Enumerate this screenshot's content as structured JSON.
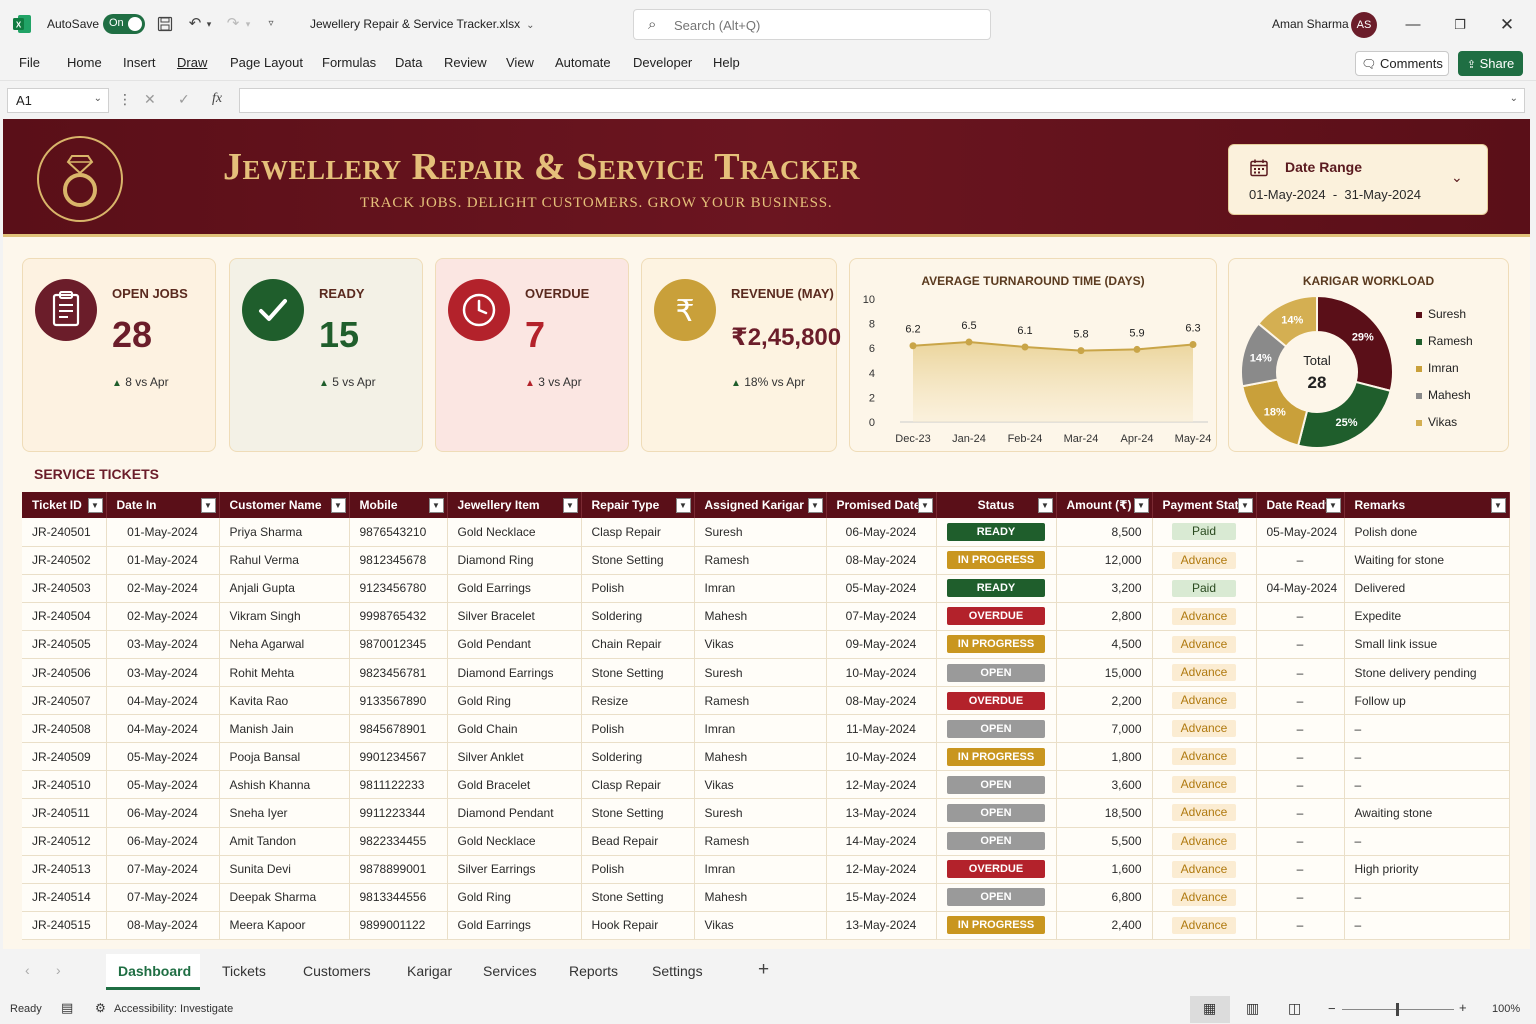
{
  "app": {
    "autosave_label": "AutoSave",
    "autosave_state": "On",
    "file_name": "Jewellery Repair & Service Tracker.xlsx",
    "search_placeholder": "Search (Alt+Q)",
    "user_name": "Aman Sharma",
    "user_initials": "AS"
  },
  "menu": [
    "File",
    "Home",
    "Insert",
    "Draw",
    "Page Layout",
    "Formulas",
    "Data",
    "Review",
    "View",
    "Automate",
    "Developer",
    "Help"
  ],
  "actions": {
    "comments": "Comments",
    "share": "Share"
  },
  "formula_bar": {
    "name_box": "A1",
    "fx": "fx"
  },
  "banner": {
    "title": "Jewellery Repair & Service Tracker",
    "subtitle": "TRACK JOBS. DELIGHT CUSTOMERS. GROW YOUR BUSINESS.",
    "date_label": "Date Range",
    "date_value": "01-May-2024  -  31-May-2024"
  },
  "kpis": [
    {
      "label": "OPEN JOBS",
      "value": "28",
      "delta": "8 vs Apr",
      "color": "#6b1d2a",
      "bg": "#fdf2e1"
    },
    {
      "label": "READY",
      "value": "15",
      "delta": "5 vs Apr",
      "color": "#1f5e2c",
      "bg": "#f3f1e6"
    },
    {
      "label": "OVERDUE",
      "value": "7",
      "delta": "3 vs Apr",
      "color": "#b3222b",
      "bg": "#fbe6e2"
    },
    {
      "label": "REVENUE (MAY)",
      "value": "₹2,45,800",
      "delta": "18% vs Apr",
      "color": "#6b1d2a",
      "bg": "#fdf3e1"
    }
  ],
  "chart_data": [
    {
      "type": "area",
      "title": "AVERAGE TURNAROUND TIME (DAYS)",
      "categories": [
        "Dec-23",
        "Jan-24",
        "Feb-24",
        "Mar-24",
        "Apr-24",
        "May-24"
      ],
      "values": [
        6.2,
        6.5,
        6.1,
        5.8,
        5.9,
        6.3
      ],
      "yticks": [
        "10",
        "8",
        "6",
        "4",
        "2",
        "0"
      ],
      "ylim": [
        0,
        10
      ],
      "grid": false,
      "color": "#c9a548"
    },
    {
      "type": "pie",
      "title": "KARIGAR WORKLOAD",
      "center_label": "Total",
      "center_value": "28",
      "slices": [
        {
          "name": "Suresh",
          "value": 29,
          "label": "29%",
          "color": "#5a0f18"
        },
        {
          "name": "Ramesh",
          "value": 25,
          "label": "25%",
          "color": "#1f5e2c"
        },
        {
          "name": "Imran",
          "value": 18,
          "label": "18%",
          "color": "#c9a03a"
        },
        {
          "name": "Mahesh",
          "value": 14,
          "label": "14%",
          "color": "#8a8a8a"
        },
        {
          "name": "Vikas",
          "value": 14,
          "label": "14%",
          "color": "#d4af52"
        }
      ],
      "legend_position": "right"
    }
  ],
  "tickets": {
    "title": "SERVICE TICKETS",
    "columns": [
      "Ticket ID",
      "Date In",
      "Customer Name",
      "Mobile",
      "Jewellery Item",
      "Repair Type",
      "Assigned Karigar",
      "Promised Date",
      "Status",
      "Amount (₹)",
      "Payment Status",
      "Date Ready",
      "Remarks"
    ],
    "rows": [
      [
        "JR-240501",
        "01-May-2024",
        "Priya Sharma",
        "9876543210",
        "Gold Necklace",
        "Clasp Repair",
        "Suresh",
        "06-May-2024",
        "READY",
        "8,500",
        "Paid",
        "05-May-2024",
        "Polish done"
      ],
      [
        "JR-240502",
        "01-May-2024",
        "Rahul Verma",
        "9812345678",
        "Diamond Ring",
        "Stone Setting",
        "Ramesh",
        "08-May-2024",
        "IN PROGRESS",
        "12,000",
        "Advance",
        "–",
        "Waiting for stone"
      ],
      [
        "JR-240503",
        "02-May-2024",
        "Anjali Gupta",
        "9123456780",
        "Gold Earrings",
        "Polish",
        "Imran",
        "05-May-2024",
        "READY",
        "3,200",
        "Paid",
        "04-May-2024",
        "Delivered"
      ],
      [
        "JR-240504",
        "02-May-2024",
        "Vikram Singh",
        "9998765432",
        "Silver Bracelet",
        "Soldering",
        "Mahesh",
        "07-May-2024",
        "OVERDUE",
        "2,800",
        "Advance",
        "–",
        "Expedite"
      ],
      [
        "JR-240505",
        "03-May-2024",
        "Neha Agarwal",
        "9870012345",
        "Gold Pendant",
        "Chain Repair",
        "Vikas",
        "09-May-2024",
        "IN PROGRESS",
        "4,500",
        "Advance",
        "–",
        "Small link issue"
      ],
      [
        "JR-240506",
        "03-May-2024",
        "Rohit Mehta",
        "9823456781",
        "Diamond Earrings",
        "Stone Setting",
        "Suresh",
        "10-May-2024",
        "OPEN",
        "15,000",
        "Advance",
        "–",
        "Stone delivery pending"
      ],
      [
        "JR-240507",
        "04-May-2024",
        "Kavita Rao",
        "9133567890",
        "Gold Ring",
        "Resize",
        "Ramesh",
        "08-May-2024",
        "OVERDUE",
        "2,200",
        "Advance",
        "–",
        "Follow up"
      ],
      [
        "JR-240508",
        "04-May-2024",
        "Manish Jain",
        "9845678901",
        "Gold Chain",
        "Polish",
        "Imran",
        "11-May-2024",
        "OPEN",
        "7,000",
        "Advance",
        "–",
        "–"
      ],
      [
        "JR-240509",
        "05-May-2024",
        "Pooja Bansal",
        "9901234567",
        "Silver Anklet",
        "Soldering",
        "Mahesh",
        "10-May-2024",
        "IN PROGRESS",
        "1,800",
        "Advance",
        "–",
        "–"
      ],
      [
        "JR-240510",
        "05-May-2024",
        "Ashish Khanna",
        "9811122233",
        "Gold Bracelet",
        "Clasp Repair",
        "Vikas",
        "12-May-2024",
        "OPEN",
        "3,600",
        "Advance",
        "–",
        "–"
      ],
      [
        "JR-240511",
        "06-May-2024",
        "Sneha Iyer",
        "9911223344",
        "Diamond Pendant",
        "Stone Setting",
        "Suresh",
        "13-May-2024",
        "OPEN",
        "18,500",
        "Advance",
        "–",
        "Awaiting stone"
      ],
      [
        "JR-240512",
        "06-May-2024",
        "Amit Tandon",
        "9822334455",
        "Gold Necklace",
        "Bead Repair",
        "Ramesh",
        "14-May-2024",
        "OPEN",
        "5,500",
        "Advance",
        "–",
        "–"
      ],
      [
        "JR-240513",
        "07-May-2024",
        "Sunita Devi",
        "9878899001",
        "Silver Earrings",
        "Polish",
        "Imran",
        "12-May-2024",
        "OVERDUE",
        "1,600",
        "Advance",
        "–",
        "High priority"
      ],
      [
        "JR-240514",
        "07-May-2024",
        "Deepak Sharma",
        "9813344556",
        "Gold Ring",
        "Stone Setting",
        "Mahesh",
        "15-May-2024",
        "OPEN",
        "6,800",
        "Advance",
        "–",
        "–"
      ],
      [
        "JR-240515",
        "08-May-2024",
        "Meera Kapoor",
        "9899001122",
        "Gold Earrings",
        "Hook Repair",
        "Vikas",
        "13-May-2024",
        "IN PROGRESS",
        "2,400",
        "Advance",
        "–",
        "–"
      ]
    ],
    "status_colors": {
      "READY": "#1f5e2c",
      "IN PROGRESS": "#c9961f",
      "OVERDUE": "#b3222b",
      "OPEN": "#9a9a9a"
    },
    "payment_colors": {
      "Paid": {
        "bg": "#d9ead3",
        "fg": "#2a4a1f"
      },
      "Advance": {
        "bg": "#fbecd2",
        "fg": "#b07a10"
      }
    }
  },
  "sheet_tabs": [
    "Dashboard",
    "Tickets",
    "Customers",
    "Karigar",
    "Services",
    "Reports",
    "Settings"
  ],
  "active_tab": "Dashboard",
  "status_bar": {
    "ready": "Ready",
    "accessibility": "Accessibility: Investigate",
    "zoom": "100%"
  }
}
